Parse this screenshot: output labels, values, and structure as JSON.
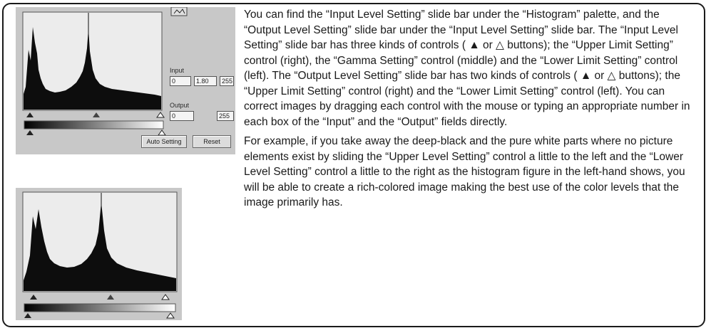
{
  "top_panel": {
    "input_label": "Input",
    "input_values": [
      "0",
      "1.80",
      "255"
    ],
    "output_label": "Output",
    "output_values": [
      "0",
      "255"
    ],
    "auto_setting_label": "Auto Setting",
    "reset_label": "Reset"
  },
  "body_text": {
    "paragraph1": "You can find the “Input Level Setting” slide bar under the “Histogram” palette, and the “Output Level Setting” slide bar under the “Input Level Setting” slide bar. The “Input Level Setting” slide bar has three kinds of controls ( ▲ or △ buttons); the “Upper Limit Setting” control (right), the “Gamma Setting” control (middle) and the “Lower Limit Setting” control (left). The “Output Level Setting” slide bar has two kinds of controls ( ▲ or △ buttons); the “Upper Limit Setting” control (right) and the “Lower Limit Setting” control (left). You can correct images by dragging each control with the mouse or typing an appropriate number in each box of the “Input” and the “Output” fields directly.",
    "paragraph2": "For example, if you take away the deep-black and the pure white parts where no picture elements exist by sliding the “Upper Level Setting” control a little to the left and the “Lower Level Setting” control a little to the right as the histogram figure in the left-hand shows, you will be able to create a rich-colored image making the best use of the color levels that the image primarily has."
  }
}
